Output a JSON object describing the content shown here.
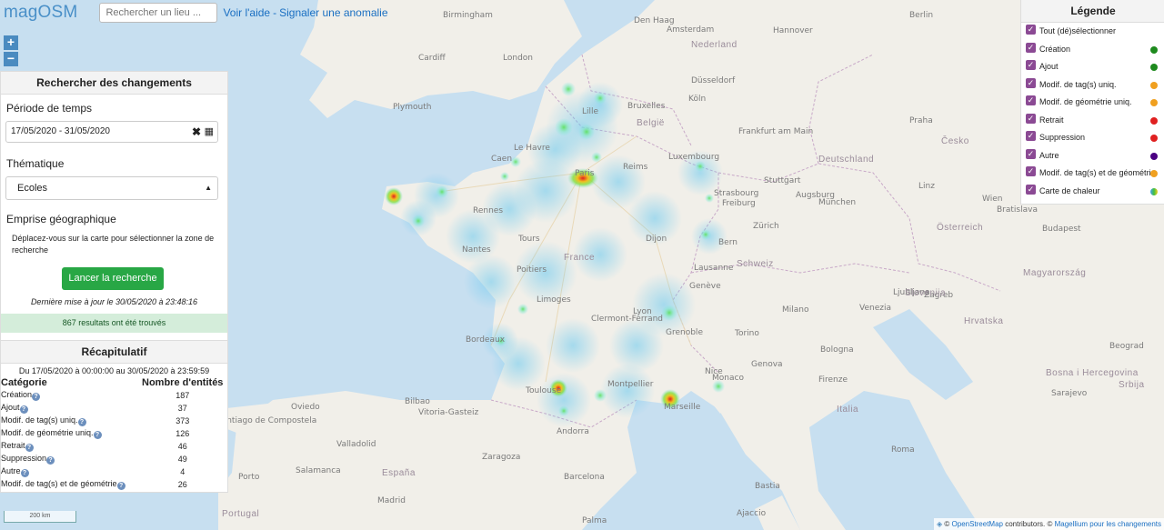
{
  "app": {
    "logo": "magOSM"
  },
  "search": {
    "placeholder": "Rechercher un lieu ..."
  },
  "links": {
    "help": "Voir l'aide",
    "separator": "-",
    "report": "Signaler une anomalie"
  },
  "zoom": {
    "in": "+",
    "out": "−"
  },
  "panel": {
    "title": "Rechercher des changements",
    "period_label": "Période de temps",
    "period_value": "17/05/2020 - 31/05/2020",
    "theme_label": "Thématique",
    "theme_value": "Ecoles",
    "area_label": "Emprise géographique",
    "area_hint": "Déplacez-vous sur la carte pour sélectionner la zone de recherche",
    "search_button": "Lancer la recherche",
    "last_update": "Dernière mise à jour le 30/05/2020 à 23:48:16",
    "results": "867 resultats ont été trouvés"
  },
  "summary": {
    "title": "Récapitulatif",
    "dates": "Du 17/05/2020 à 00:00:00 au 30/05/2020 à 23:59:59",
    "col_category": "Catégorie",
    "col_count": "Nombre d'entités",
    "rows": [
      {
        "label": "Création",
        "count": "187"
      },
      {
        "label": "Ajout",
        "count": "37"
      },
      {
        "label": "Modif. de tag(s) uniq.",
        "count": "373"
      },
      {
        "label": "Modif. de géométrie uniq.",
        "count": "126"
      },
      {
        "label": "Retrait",
        "count": "46"
      },
      {
        "label": "Suppression",
        "count": "49"
      },
      {
        "label": "Autre",
        "count": "4"
      },
      {
        "label": "Modif. de tag(s) et de géométrie",
        "count": "26"
      }
    ]
  },
  "legend": {
    "title": "Légende",
    "items": [
      {
        "label": "Tout (dé)sélectionner",
        "color": ""
      },
      {
        "label": "Création",
        "color": "#1e8a1e"
      },
      {
        "label": "Ajout",
        "color": "#1e8a1e"
      },
      {
        "label": "Modif. de tag(s) uniq.",
        "color": "#f0a020"
      },
      {
        "label": "Modif. de géométrie uniq.",
        "color": "#f0a020"
      },
      {
        "label": "Retrait",
        "color": "#e02020"
      },
      {
        "label": "Suppression",
        "color": "#e02020"
      },
      {
        "label": "Autre",
        "color": "#4b0082"
      },
      {
        "label": "Modif. de tag(s) et de géométrie",
        "color": "#f0a020"
      },
      {
        "label": "Carte de chaleur",
        "color": "gradient"
      }
    ]
  },
  "scale": "200 km",
  "attribution": {
    "prefix": "© ",
    "osm": "OpenStreetMap",
    "contrib": " contributors. © ",
    "magellium": "Magellium pour les changements"
  },
  "map_labels": {
    "cities": [
      "Birmingham",
      "London",
      "Cardiff",
      "Plymouth",
      "Den Haag",
      "Amsterdam",
      "Hannover",
      "Berlin",
      "Düsseldorf",
      "Köln",
      "Bruxelles",
      "Lille",
      "Frankfurt am Main",
      "Praha",
      "Luxembourg",
      "Le Havre",
      "Caen",
      "Paris",
      "Reims",
      "Strasbourg",
      "Stuttgart",
      "Rennes",
      "Nantes",
      "Tours",
      "Dijon",
      "Zürich",
      "Bern",
      "München",
      "Wien",
      "Poitiers",
      "Limoges",
      "Lyon",
      "Genève",
      "Milano",
      "Torino",
      "Venezia",
      "Bordeaux",
      "Clermont-Ferrand",
      "Grenoble",
      "Toulouse",
      "Montpellier",
      "Marseille",
      "Nice",
      "Monaco",
      "Genova",
      "Bologna",
      "Firenze",
      "Zagreb",
      "Budapest",
      "Beograd",
      "Sarajevo",
      "Roma",
      "Andorra",
      "Barcelona",
      "Zaragoza",
      "Bilbao",
      "Vitoria-Gasteiz",
      "Valladolid",
      "Salamanca",
      "Madrid",
      "Palma",
      "Santiago de Compostela",
      "Oviedo",
      "Porto",
      "Ljubljana",
      "Bratislava",
      "Linz",
      "Augsburg",
      "Freiburg",
      "Lausanne",
      "Ajaccio",
      "Bastia"
    ],
    "countries": [
      "France",
      "Deutschland",
      "Nederland",
      "België",
      "Schweiz",
      "Italia",
      "España",
      "Portugal",
      "Österreich",
      "Česko",
      "Magyarország",
      "Hrvatska",
      "Slovenija",
      "Bosna i Hercegovina",
      "Srbija"
    ]
  }
}
